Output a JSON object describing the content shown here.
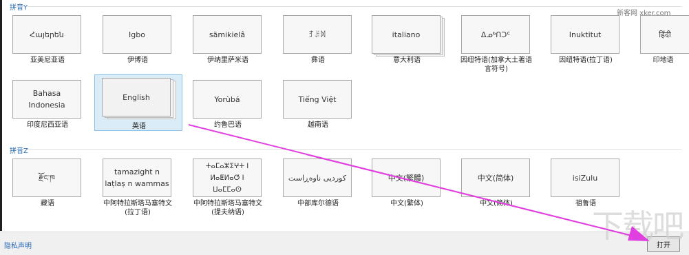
{
  "groups": {
    "y": {
      "header": "拼音Y"
    },
    "z": {
      "header": "拼音Z"
    }
  },
  "languages_y": [
    {
      "native": "Հայերեն",
      "label": "亚美尼亚语"
    },
    {
      "native": "Igbo",
      "label": "伊博语"
    },
    {
      "native": "sämikielâ",
      "label": "伊纳里萨米语"
    },
    {
      "native": "ꆈꌠꉙ",
      "label": "彝语"
    },
    {
      "native": "italiano",
      "label": "意大利语"
    },
    {
      "native": "ᐃᓄᒃᑎᑐᑦ",
      "label": "因纽特语(加拿大土著语言符号)"
    },
    {
      "native": "Inuktitut",
      "label": "因纽特语(拉丁语)"
    },
    {
      "native": "हिंदी",
      "label": "印地语"
    },
    {
      "native": "Bahasa Indonesia",
      "label": "印度尼西亚语"
    },
    {
      "native": "English",
      "label": "英语"
    },
    {
      "native": "Yorùbá",
      "label": "约鲁巴语"
    },
    {
      "native": "Tiếng Việt",
      "label": "越南语"
    }
  ],
  "languages_z": [
    {
      "native": "རྫོང་ཁ",
      "label": "藏语"
    },
    {
      "native": "tamazight n laṭlaṣ n wammas",
      "label": "中阿特拉斯塔马塞特文(拉丁语)"
    },
    {
      "native": "ⵜⴰⵎⴰⵣⵉⵖⵜ ⵏ ⵍⴰⵟⵍⴰⵚ ⵏ ⵡⴰⵎⵎⴰⵙ",
      "label": "中阿特拉斯塔马塞特文(提夫纳语)"
    },
    {
      "native": "کوردیی ناوەڕاست",
      "label": "中部库尔德语"
    },
    {
      "native": "中文(繁體)",
      "label": "中文(繁体)"
    },
    {
      "native": "中文(简体)",
      "label": "中文(简体)"
    },
    {
      "native": "isiZulu",
      "label": "祖鲁语"
    }
  ],
  "footer": {
    "privacy_link": "隐私声明",
    "open_button": "打开"
  },
  "watermarks": {
    "site": "新客网 xker.com",
    "logo": "下载吧"
  },
  "colors": {
    "link": "#2b6cb8",
    "selection_bg": "#d9ecf8",
    "selection_border": "#8bbfe6",
    "annotation_arrow": "#e040e0"
  },
  "selected_language": "English"
}
